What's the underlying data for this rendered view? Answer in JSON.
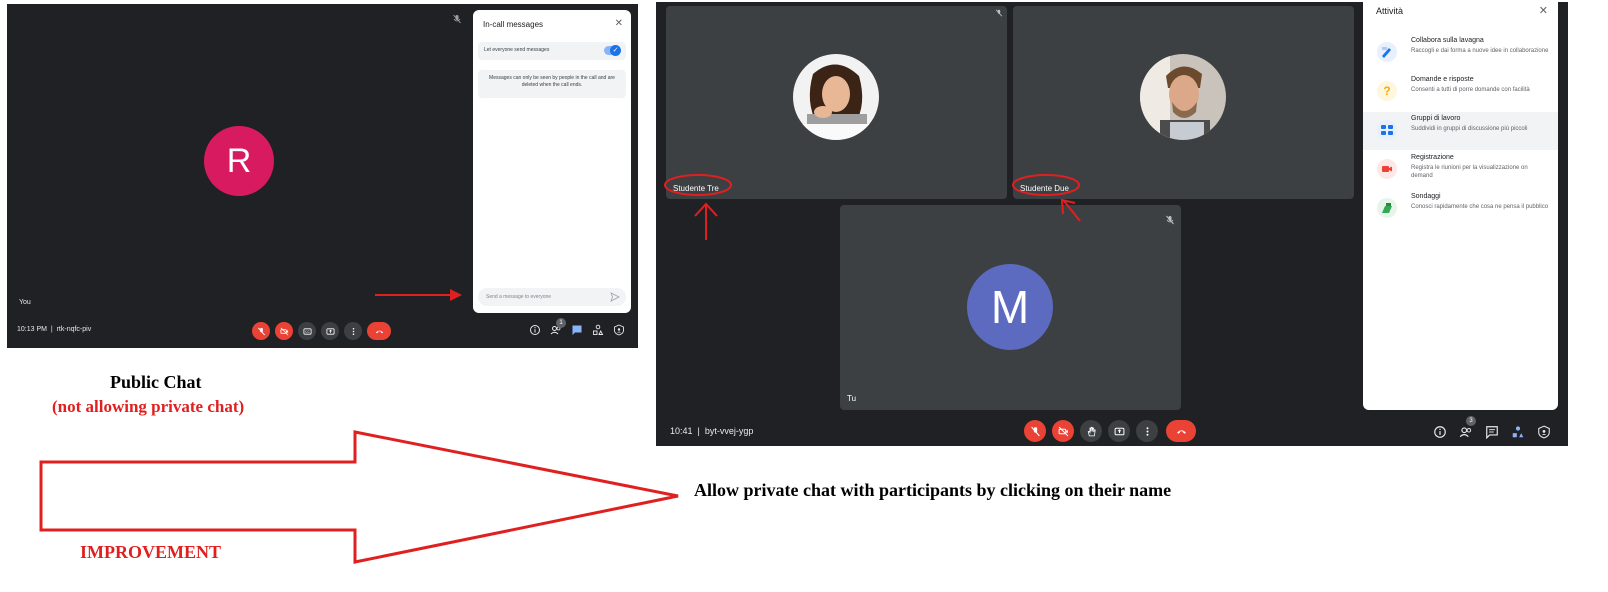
{
  "left_screenshot": {
    "participant_initial": "R",
    "participant_label": "You",
    "meeting_time": "10:13 PM",
    "meeting_code": "rtk-nqfc-piv",
    "people_count": "1",
    "chat_panel": {
      "title": "In-call messages",
      "toggle_label": "Let everyone send messages",
      "toggle_on": true,
      "info_text": "Messages can only be seen by people in the call and are deleted when the call ends.",
      "input_placeholder": "Send a message to everyone"
    }
  },
  "right_screenshot": {
    "tiles": [
      {
        "name": "Studente Tre"
      },
      {
        "name": "Studente Due"
      },
      {
        "name": "Tu",
        "initial": "M"
      }
    ],
    "meeting_time": "10:41",
    "meeting_code": "byt-vvej-ygp",
    "people_count": "3",
    "activities_panel": {
      "title": "Attività",
      "items": [
        {
          "name": "Collabora sulla lavagna",
          "description": "Raccogli e dai forma a nuove idee in collaborazione",
          "icon": "whiteboard-icon"
        },
        {
          "name": "Domande e risposte",
          "description": "Consenti a tutti di porre domande con facilità",
          "icon": "question-icon"
        },
        {
          "name": "Gruppi di lavoro",
          "description": "Suddividi in gruppi di discussione più piccoli",
          "icon": "breakout-icon",
          "highlighted": true
        },
        {
          "name": "Registrazione",
          "description": "Registra le riunioni per la visualizzazione on demand",
          "icon": "record-icon"
        },
        {
          "name": "Sondaggi",
          "description": "Conosci rapidamente che cosa ne pensa il pubblico",
          "icon": "poll-icon"
        }
      ]
    }
  },
  "annotations": {
    "left_caption": "Public Chat",
    "left_subcaption": "(not allowing private chat)",
    "arrow_label": "IMPROVEMENT",
    "main_caption": "Allow private chat with participants by clicking on their name"
  },
  "colors": {
    "meet_background": "#202124",
    "tile_background": "#3c4043",
    "control_red": "#ea4335",
    "annotation_red": "#e02020",
    "avatar_r": "#d81b60",
    "avatar_m": "#5c6bc0",
    "accent_blue": "#1a73e8"
  }
}
